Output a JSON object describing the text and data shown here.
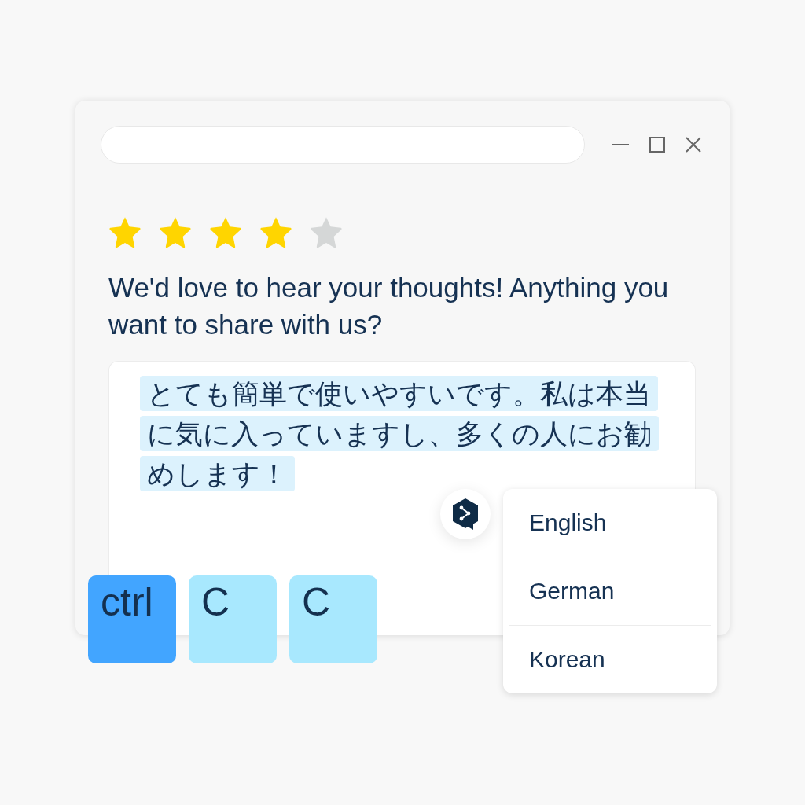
{
  "rating": {
    "stars": 4
  },
  "prompt": "We'd love to hear your thoughts! Anything you want to share with us?",
  "feedback": {
    "value": "とても簡単で使いやすいです。私は本当に気に入っていますし、多くの人にお勧めします！",
    "selected": true
  },
  "language_menu": {
    "items": [
      {
        "label": "English",
        "selected": false
      },
      {
        "label": "German",
        "selected": false
      },
      {
        "label": "Korean",
        "selected": false
      }
    ]
  },
  "shortcut_keys": [
    {
      "label": "ctrl",
      "kind": "modifier"
    },
    {
      "label": "C",
      "kind": "letter"
    },
    {
      "label": "C",
      "kind": "letter"
    }
  ]
}
